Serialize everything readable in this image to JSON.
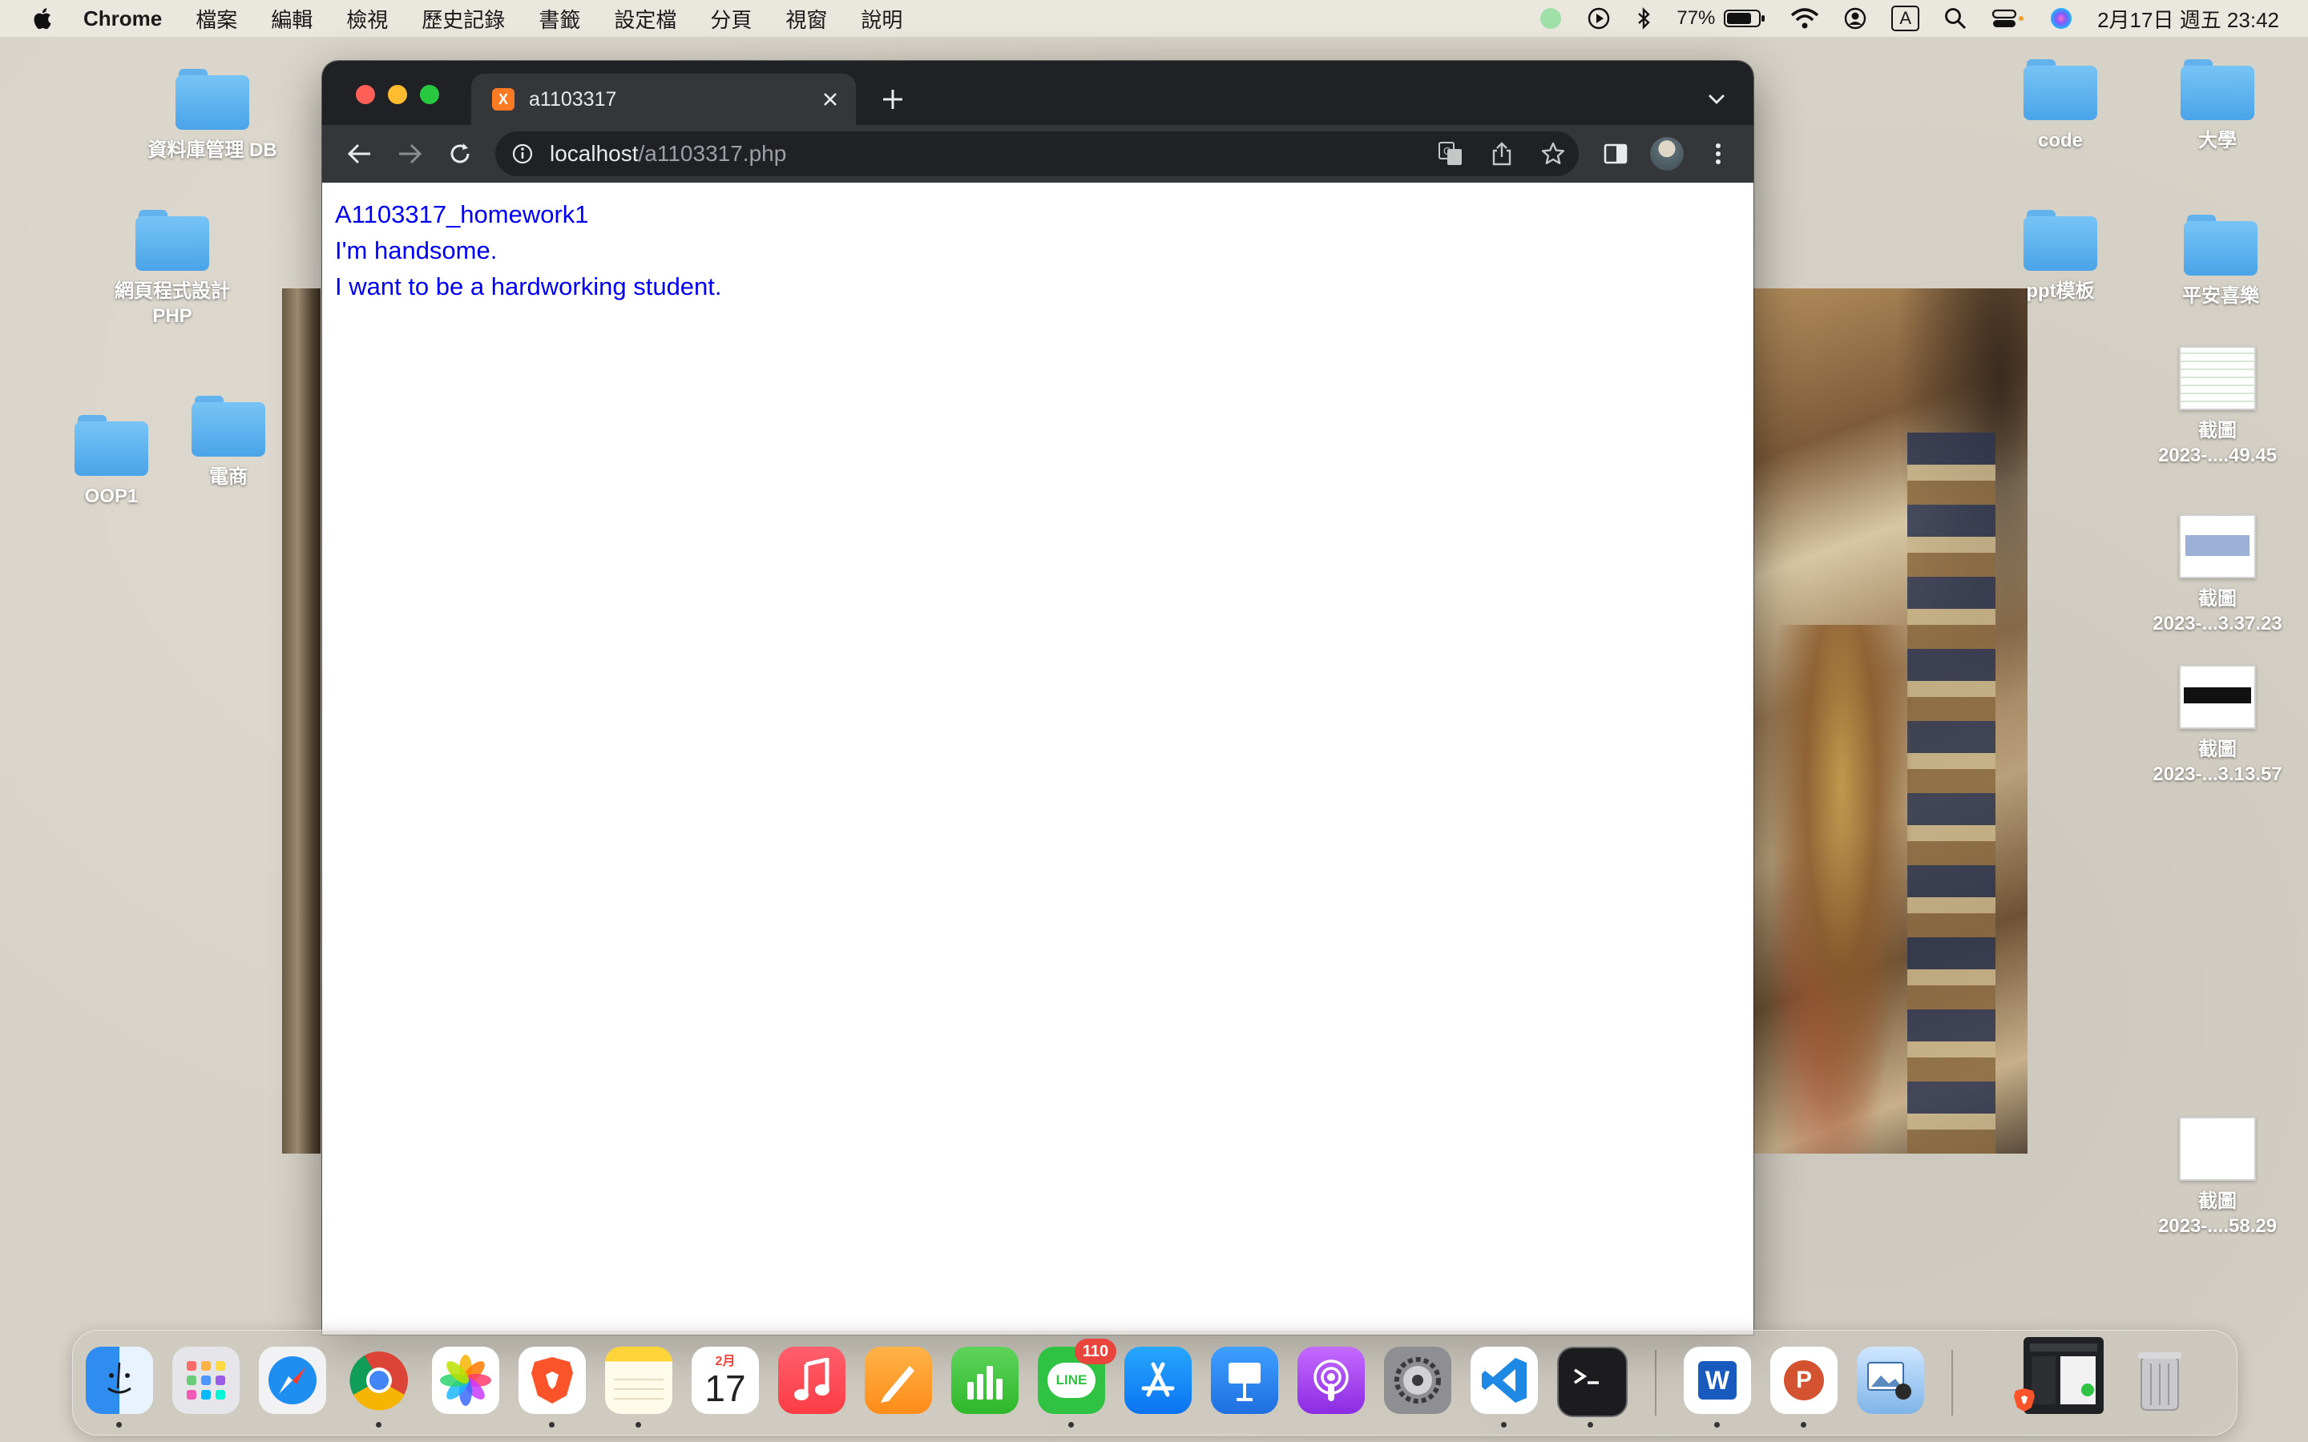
{
  "menubar": {
    "app_name": "Chrome",
    "items": [
      "檔案",
      "編輯",
      "檢視",
      "歷史記錄",
      "書籤",
      "設定檔",
      "分頁",
      "視窗",
      "說明"
    ],
    "battery": "77%",
    "input_method": "A",
    "clock": "2月17日 週五 23:42"
  },
  "desktop": {
    "left_icons": [
      "資料庫管理 DB",
      "網頁程式設計\nPHP",
      "OOP1",
      "電商"
    ],
    "right_icons": [
      "code",
      "大學",
      "ppt模板",
      "平安喜樂"
    ],
    "screenshots": [
      {
        "line1": "截圖",
        "line2": "2023-....49.45"
      },
      {
        "line1": "截圖",
        "line2": "2023-...3.37.23"
      },
      {
        "line1": "截圖",
        "line2": "2023-...3.13.57"
      },
      {
        "line1": "截圖",
        "line2": "2023-....58.29"
      }
    ]
  },
  "browser": {
    "tab_title": "a1103317",
    "favicon_text": "X",
    "url_host": "localhost",
    "url_path": "/a1103317.php",
    "page_lines": [
      "A1103317_homework1",
      "I'm handsome.",
      "I want to be a hardworking student."
    ]
  },
  "dock": {
    "calendar_month": "2月",
    "calendar_day": "17",
    "line_badge": "110",
    "line_label": "LINE",
    "word_letter": "W",
    "ppt_letter": "P",
    "apps": [
      "finder",
      "launchpad",
      "safari",
      "chrome",
      "photos",
      "brave",
      "notes",
      "calendar",
      "music",
      "pages",
      "numbers",
      "line",
      "app-store",
      "keynote",
      "podcasts",
      "system-settings",
      "vscode",
      "terminal",
      "word",
      "powerpoint",
      "preview"
    ]
  },
  "colors": {
    "link_blue": "#0000ee",
    "chrome_dark": "#202124",
    "chrome_toolbar": "#35363a",
    "folder_blue": "#5fb4f0"
  }
}
